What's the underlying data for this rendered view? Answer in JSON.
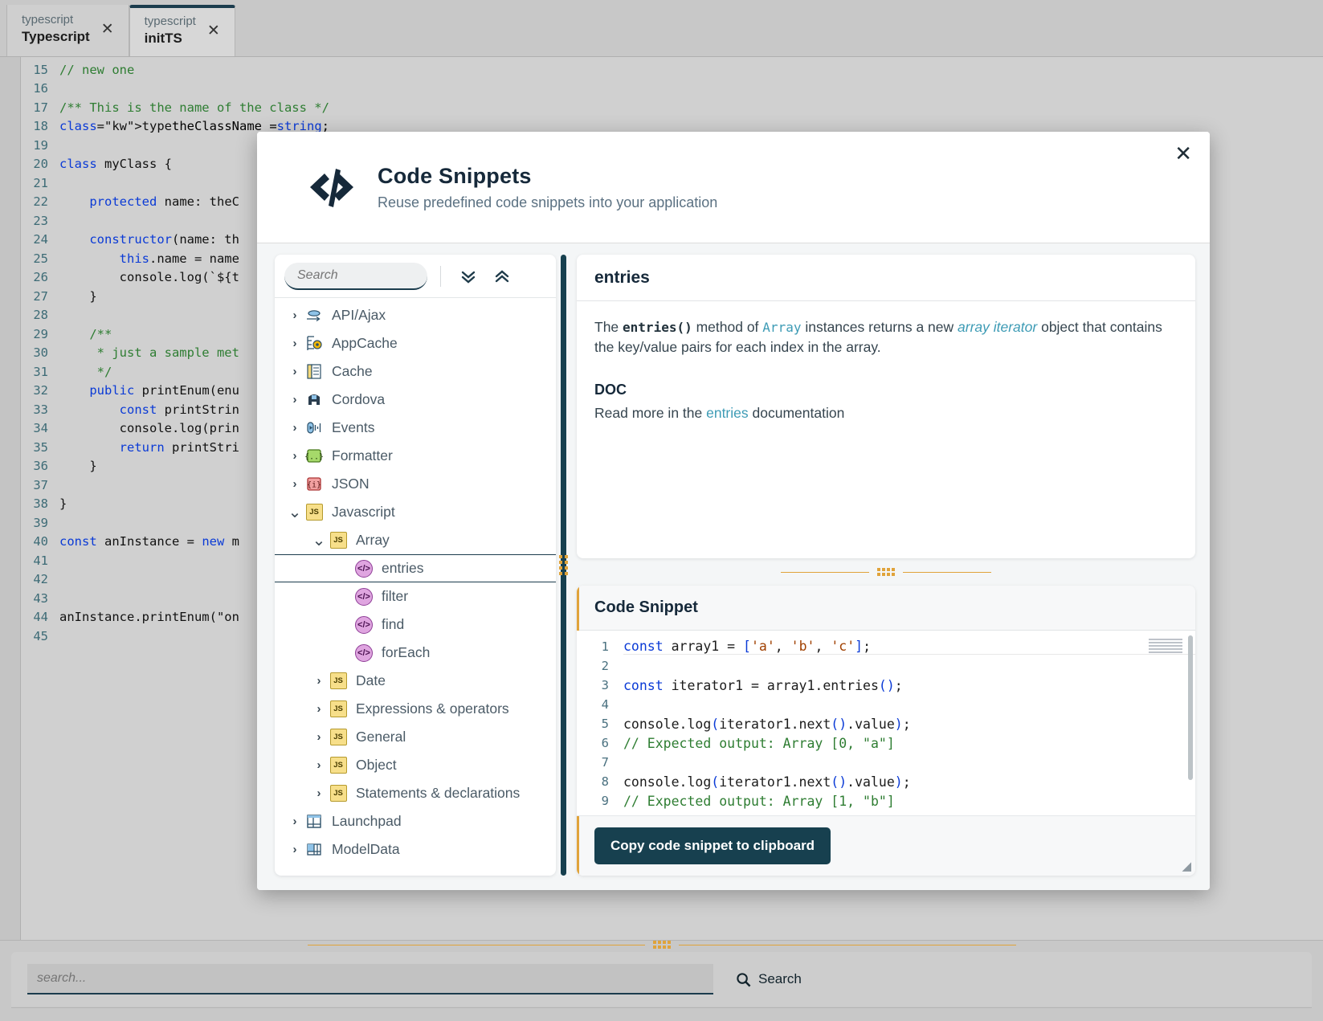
{
  "ide": {
    "tabs": [
      {
        "sub": "typescript",
        "title": "Typescript",
        "active": false,
        "close": "✕"
      },
      {
        "sub": "typescript",
        "title": "initTS",
        "active": true,
        "close": "✕"
      }
    ],
    "editor_lines": [
      {
        "no": "15",
        "text": "// new one",
        "cls": "cmt"
      },
      {
        "no": "16",
        "text": "",
        "cls": ""
      },
      {
        "no": "17",
        "text": "/** This is the name of the class */",
        "cls": "cmt"
      },
      {
        "no": "18",
        "text": "type theClassName = string;",
        "cls": "mix-type"
      },
      {
        "no": "19",
        "text": "",
        "cls": ""
      },
      {
        "no": "20",
        "text": "class myClass {",
        "cls": "mix-class"
      },
      {
        "no": "21",
        "text": "",
        "cls": ""
      },
      {
        "no": "22",
        "text": "    protected name: theC",
        "cls": "mix-prot"
      },
      {
        "no": "23",
        "text": "",
        "cls": ""
      },
      {
        "no": "24",
        "text": "    constructor(name: th",
        "cls": "mix-ctor"
      },
      {
        "no": "25",
        "text": "        this.name = name",
        "cls": "mix-this"
      },
      {
        "no": "26",
        "text": "        console.log(`${t",
        "cls": ""
      },
      {
        "no": "27",
        "text": "    }",
        "cls": ""
      },
      {
        "no": "28",
        "text": "",
        "cls": ""
      },
      {
        "no": "29",
        "text": "    /**",
        "cls": "cmt"
      },
      {
        "no": "30",
        "text": "     * just a sample met",
        "cls": "cmt"
      },
      {
        "no": "31",
        "text": "     */",
        "cls": "cmt"
      },
      {
        "no": "32",
        "text": "    public printEnum(enu",
        "cls": "mix-pub"
      },
      {
        "no": "33",
        "text": "        const printStrin",
        "cls": "mix-const"
      },
      {
        "no": "34",
        "text": "        console.log(prin",
        "cls": ""
      },
      {
        "no": "35",
        "text": "        return printStri",
        "cls": "mix-ret"
      },
      {
        "no": "36",
        "text": "    }",
        "cls": ""
      },
      {
        "no": "37",
        "text": "",
        "cls": ""
      },
      {
        "no": "38",
        "text": "}",
        "cls": ""
      },
      {
        "no": "39",
        "text": "",
        "cls": ""
      },
      {
        "no": "40",
        "text": "const anInstance = new m",
        "cls": "mix-inst"
      },
      {
        "no": "41",
        "text": "",
        "cls": ""
      },
      {
        "no": "42",
        "text": "",
        "cls": ""
      },
      {
        "no": "43",
        "text": "",
        "cls": ""
      },
      {
        "no": "44",
        "text": "anInstance.printEnum(\"on",
        "cls": ""
      },
      {
        "no": "45",
        "text": "",
        "cls": ""
      }
    ],
    "bottom_search": {
      "placeholder": "search...",
      "value": "",
      "button_label": "Search",
      "icon": "search-icon"
    }
  },
  "dialog": {
    "icon": "code-brackets-icon",
    "title": "Code Snippets",
    "subtitle": "Reuse predefined code snippets into your application",
    "close_label": "✕",
    "tree_toolbar": {
      "search_placeholder": "Search",
      "search_value": "",
      "search_icon": "search-icon",
      "expand_all_icon": "chevrons-down-icon",
      "collapse_all_icon": "chevrons-up-icon"
    },
    "tree": [
      {
        "label": "API/Ajax",
        "depth": 1,
        "state": "collapsed",
        "icon": "api-ajax-icon"
      },
      {
        "label": "AppCache",
        "depth": 1,
        "state": "collapsed",
        "icon": "appcache-icon"
      },
      {
        "label": "Cache",
        "depth": 1,
        "state": "collapsed",
        "icon": "cache-icon"
      },
      {
        "label": "Cordova",
        "depth": 1,
        "state": "collapsed",
        "icon": "cordova-icon"
      },
      {
        "label": "Events",
        "depth": 1,
        "state": "collapsed",
        "icon": "events-icon"
      },
      {
        "label": "Formatter",
        "depth": 1,
        "state": "collapsed",
        "icon": "formatter-icon"
      },
      {
        "label": "JSON",
        "depth": 1,
        "state": "collapsed",
        "icon": "json-icon"
      },
      {
        "label": "Javascript",
        "depth": 1,
        "state": "expanded",
        "icon": "js-icon"
      },
      {
        "label": "Array",
        "depth": 2,
        "state": "expanded",
        "icon": "js-icon"
      },
      {
        "label": "entries",
        "depth": 3,
        "state": "leaf",
        "icon": "snippet-icon",
        "selected": true
      },
      {
        "label": "filter",
        "depth": 3,
        "state": "leaf",
        "icon": "snippet-icon"
      },
      {
        "label": "find",
        "depth": 3,
        "state": "leaf",
        "icon": "snippet-icon"
      },
      {
        "label": "forEach",
        "depth": 3,
        "state": "leaf",
        "icon": "snippet-icon"
      },
      {
        "label": "Date",
        "depth": 2,
        "state": "collapsed",
        "icon": "js-icon"
      },
      {
        "label": "Expressions & operators",
        "depth": 2,
        "state": "collapsed",
        "icon": "js-icon"
      },
      {
        "label": "General",
        "depth": 2,
        "state": "collapsed",
        "icon": "js-icon"
      },
      {
        "label": "Object",
        "depth": 2,
        "state": "collapsed",
        "icon": "js-icon"
      },
      {
        "label": "Statements & declarations",
        "depth": 2,
        "state": "collapsed",
        "icon": "js-icon"
      },
      {
        "label": "Launchpad",
        "depth": 1,
        "state": "collapsed",
        "icon": "launchpad-icon"
      },
      {
        "label": "ModelData",
        "depth": 1,
        "state": "collapsed",
        "icon": "modeldata-icon"
      }
    ],
    "doc": {
      "title": "entries",
      "desc_parts": [
        {
          "t": "The ",
          "k": "plain"
        },
        {
          "t": "entries()",
          "k": "code"
        },
        {
          "t": " method of ",
          "k": "plain"
        },
        {
          "t": "Array",
          "k": "mono-blue"
        },
        {
          "t": " instances returns a new ",
          "k": "plain"
        },
        {
          "t": "array iterator",
          "k": "italic-link"
        },
        {
          "t": " object that contains the key/value pairs for each index in the array.",
          "k": "plain"
        }
      ],
      "doc_heading": "DOC",
      "doc_line_parts": [
        {
          "t": "Read more in the ",
          "k": "plain"
        },
        {
          "t": "entries",
          "k": "link"
        },
        {
          "t": " documentation",
          "k": "plain"
        }
      ]
    },
    "snippet": {
      "heading": "Code Snippet",
      "lines": [
        {
          "n": "1",
          "tokens": [
            {
              "t": "const ",
              "k": "kw"
            },
            {
              "t": "array1 = ",
              "k": "p"
            },
            {
              "t": "[",
              "k": "br"
            },
            {
              "t": "'a'",
              "k": "str"
            },
            {
              "t": ", ",
              "k": "p"
            },
            {
              "t": "'b'",
              "k": "str"
            },
            {
              "t": ", ",
              "k": "p"
            },
            {
              "t": "'c'",
              "k": "str"
            },
            {
              "t": "]",
              "k": "br"
            },
            {
              "t": ";",
              "k": "p"
            }
          ],
          "current": true
        },
        {
          "n": "2",
          "tokens": []
        },
        {
          "n": "3",
          "tokens": [
            {
              "t": "const ",
              "k": "kw"
            },
            {
              "t": "iterator1 = array1.entries",
              "k": "p"
            },
            {
              "t": "()",
              "k": "br"
            },
            {
              "t": ";",
              "k": "p"
            }
          ]
        },
        {
          "n": "4",
          "tokens": []
        },
        {
          "n": "5",
          "tokens": [
            {
              "t": "console.log",
              "k": "p"
            },
            {
              "t": "(",
              "k": "br"
            },
            {
              "t": "iterator1.next",
              "k": "p"
            },
            {
              "t": "()",
              "k": "br"
            },
            {
              "t": ".value",
              "k": "p"
            },
            {
              "t": ")",
              "k": "br"
            },
            {
              "t": ";",
              "k": "p"
            }
          ]
        },
        {
          "n": "6",
          "tokens": [
            {
              "t": "// Expected output: Array [0, \"a\"]",
              "k": "cmt"
            }
          ]
        },
        {
          "n": "7",
          "tokens": []
        },
        {
          "n": "8",
          "tokens": [
            {
              "t": "console.log",
              "k": "p"
            },
            {
              "t": "(",
              "k": "br"
            },
            {
              "t": "iterator1.next",
              "k": "p"
            },
            {
              "t": "()",
              "k": "br"
            },
            {
              "t": ".value",
              "k": "p"
            },
            {
              "t": ")",
              "k": "br"
            },
            {
              "t": ";",
              "k": "p"
            }
          ]
        },
        {
          "n": "9",
          "tokens": [
            {
              "t": "// Expected output: Array [1, \"b\"]",
              "k": "cmt"
            }
          ]
        }
      ],
      "copy_button": "Copy code snippet to clipboard",
      "resize_grip_icon": "resize-handle-icon"
    }
  },
  "colors": {
    "accent_dark": "#17404f",
    "accent_orange": "#e0a33a",
    "link_blue": "#3d9bb5",
    "js_yellow": "#f7df8a",
    "snippet_pink": "#dfa5e0"
  }
}
